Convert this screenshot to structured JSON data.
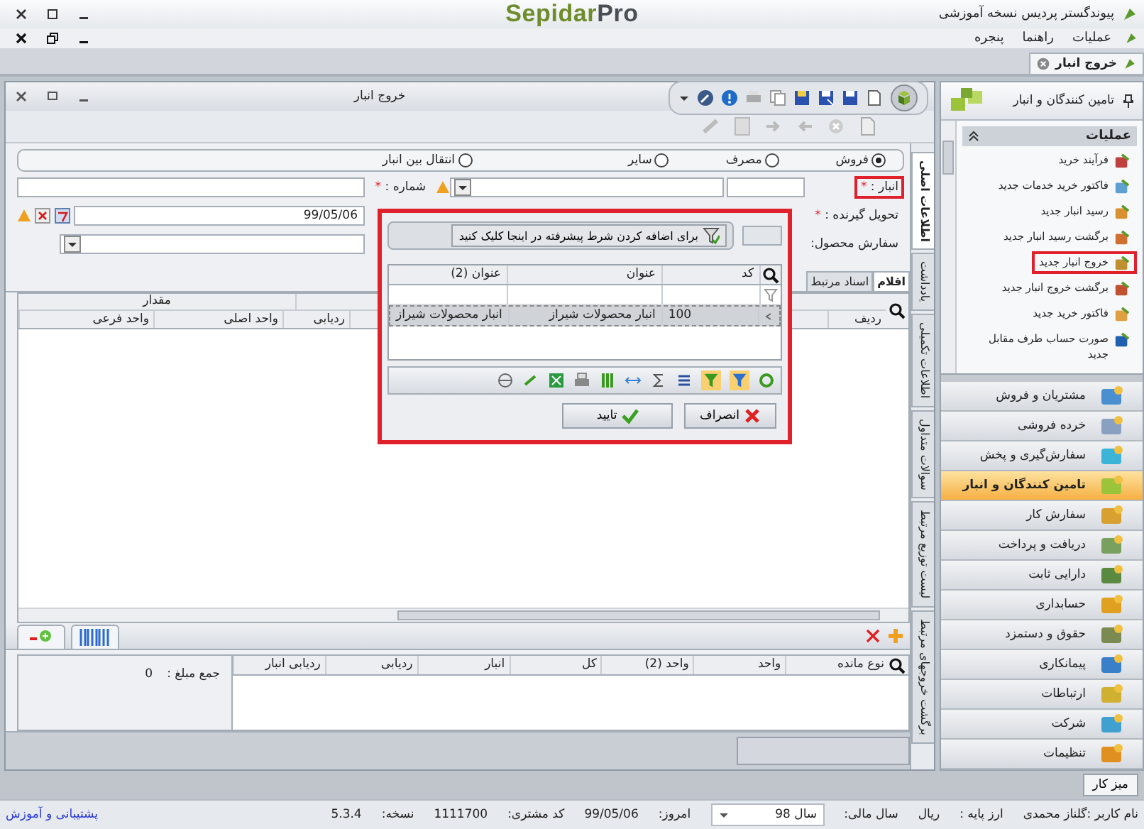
{
  "app": {
    "title": "پیوندگستر پردیس نسخه آموزشی",
    "logo": "Sepidar",
    "logo_accent": "Pro"
  },
  "menu": [
    "عملیات",
    "راهنما",
    "پنجره"
  ],
  "doc_tabs": [
    {
      "label": "خروج انبار",
      "selected": true
    }
  ],
  "document": {
    "title": "خروج انبار",
    "vertical_tabs": [
      {
        "label": "اطلاعات اصلی",
        "selected": true
      },
      {
        "label": "یادداشت",
        "selected": false
      },
      {
        "label": "اطلاعات تکمیلی",
        "selected": false
      },
      {
        "label": "سوالات متداول",
        "selected": false
      },
      {
        "label": "لیست توزیع مرتبط",
        "selected": false
      },
      {
        "label": "برگشت خروجهای مرتبط",
        "selected": false
      }
    ],
    "type_options": [
      {
        "label": "فروش",
        "selected": true
      },
      {
        "label": "مصرف",
        "selected": false
      },
      {
        "label": "سایر",
        "selected": false
      },
      {
        "label": "انتقال بین انبار",
        "selected": false
      }
    ],
    "warehouse": {
      "label": "انبار :",
      "mark": "*",
      "highlighted": true
    },
    "number": {
      "label": "شماره :",
      "mark": "*"
    },
    "receiver": {
      "label": "تحویل گیرنده :",
      "mark": "*"
    },
    "date": {
      "value": "99/05/06"
    },
    "product_order": {
      "label": "سفارش محصول:"
    },
    "item_tabs": [
      {
        "label": "اقلام",
        "selected": true
      },
      {
        "label": "اسناد مرتبط",
        "selected": false
      }
    ],
    "items_grid": {
      "group_header": "مقدار",
      "columns": [
        "ردیف",
        "ردیابی",
        "واحد اصلی",
        "واحد فرعی"
      ]
    },
    "balance_grid": {
      "columns": [
        "نوع مانده",
        "واحد",
        "واحد (2)",
        "کل",
        "انبار",
        "ردیابی",
        "ردیابی انبار"
      ]
    },
    "total": {
      "label": "جمع مبلغ :",
      "value": "0"
    }
  },
  "lookup": {
    "filter_button": "برای اضافه کردن شرط پیشرفته در اینجا کلیک کنید",
    "columns": [
      "کد",
      "عنوان",
      "عنوان (2)"
    ],
    "rows": [
      {
        "cells": [
          "100",
          "انبار محصولات شیراز",
          "انبار محصولات شیراز"
        ],
        "selected": true
      }
    ],
    "ok": "تایید",
    "cancel": "انصراف"
  },
  "sidebar": {
    "title": "تامین کنندگان و انبار",
    "operations_title": "عملیات",
    "operations": [
      {
        "label": "فرآیند خرید",
        "highlighted": false
      },
      {
        "label": "فاکتور خرید خدمات جدید",
        "highlighted": false
      },
      {
        "label": "رسید انبار جدید",
        "highlighted": false
      },
      {
        "label": "برگشت رسید انبار جدید",
        "highlighted": false
      },
      {
        "label": "خروج انبار جدید",
        "highlighted": true
      },
      {
        "label": "برگشت خروج انبار جدید",
        "highlighted": false
      },
      {
        "label": "فاکتور خرید جدید",
        "highlighted": false
      },
      {
        "label": "صورت حساب طرف مقابل جدید",
        "highlighted": false
      }
    ],
    "modules": [
      {
        "label": "مشتریان و فروش",
        "selected": false
      },
      {
        "label": "خرده فروشی",
        "selected": false
      },
      {
        "label": "سفارش‌گیری و پخش",
        "selected": false
      },
      {
        "label": "تامین کنندگان و انبار",
        "selected": true
      },
      {
        "label": "سفارش کار",
        "selected": false
      },
      {
        "label": "دریافت و پرداخت",
        "selected": false
      },
      {
        "label": "دارایی ثابت",
        "selected": false
      },
      {
        "label": "حسابداری",
        "selected": false
      },
      {
        "label": "حقوق و دستمزد",
        "selected": false
      },
      {
        "label": "پیمانکاری",
        "selected": false
      },
      {
        "label": "ارتباطات",
        "selected": false
      },
      {
        "label": "شرکت",
        "selected": false
      },
      {
        "label": "تنظیمات",
        "selected": false
      }
    ]
  },
  "taskbar": {
    "button": "میز کار"
  },
  "status": {
    "user": "نام کاربر :گلناز محمدی",
    "currency_label": "ارز پایه :",
    "currency": "ریال",
    "year_label": "سال مالی:",
    "year": "سال 98",
    "today_label": "امروز:",
    "today": "99/05/06",
    "customer_label": "کد مشتری:",
    "customer": "1111700",
    "version_label": "نسخه:",
    "version": "5.3.4",
    "support_link": "پشتیبانی و آموزش"
  }
}
